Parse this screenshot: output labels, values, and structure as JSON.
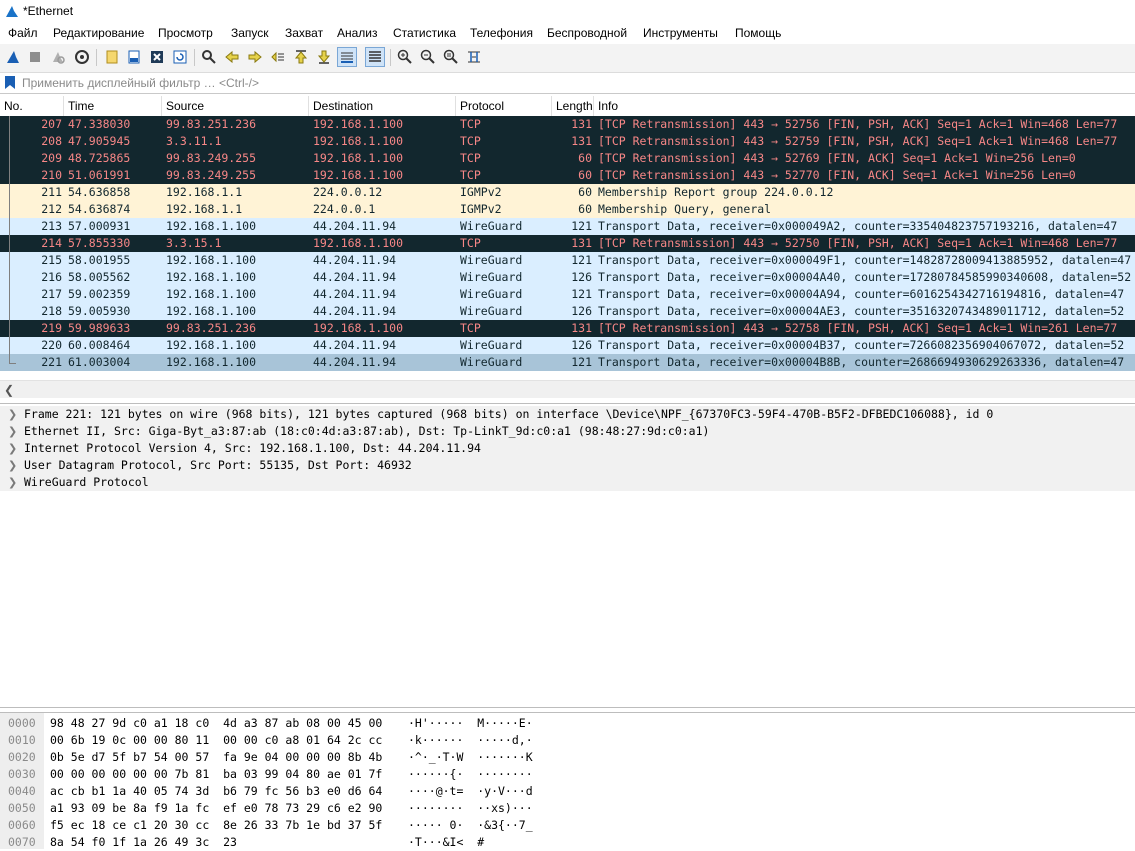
{
  "window": {
    "title": "*Ethernet"
  },
  "menu": [
    "Файл",
    "Редактирование",
    "Просмотр",
    "Запуск",
    "Захват",
    "Анализ",
    "Статистика",
    "Телефония",
    "Беспроводной",
    "Инструменты",
    "Помощь"
  ],
  "toolbar": {
    "buttons": [
      "shark-fin-start-icon",
      "stop-icon",
      "restart-icon",
      "capture-options-icon",
      "open-file-icon",
      "save-file-icon",
      "close-file-icon",
      "reload-icon",
      "find-packet-icon",
      "go-back-icon",
      "go-forward-icon",
      "go-to-packet-icon",
      "go-first-icon",
      "go-last-icon",
      "autoscroll-icon",
      "colorize-icon",
      "zoom-in-icon",
      "zoom-out-icon",
      "zoom-reset-icon",
      "resize-columns-icon"
    ]
  },
  "filter": {
    "placeholder": "Применить дисплейный фильтр … <Ctrl-/>",
    "value": ""
  },
  "packet_list": {
    "columns": [
      "No.",
      "Time",
      "Source",
      "Destination",
      "Protocol",
      "Length",
      "Info"
    ],
    "rows": [
      {
        "no": "207",
        "time": "47.338030",
        "src": "99.83.251.236",
        "dst": "192.168.1.100",
        "proto": "TCP",
        "len": "131",
        "info": "[TCP Retransmission] 443 → 52756 [FIN, PSH, ACK] Seq=1 Ack=1 Win=468 Len=77",
        "style": "tcp-bad"
      },
      {
        "no": "208",
        "time": "47.905945",
        "src": "3.3.11.1",
        "dst": "192.168.1.100",
        "proto": "TCP",
        "len": "131",
        "info": "[TCP Retransmission] 443 → 52759 [FIN, PSH, ACK] Seq=1 Ack=1 Win=468 Len=77",
        "style": "tcp-bad"
      },
      {
        "no": "209",
        "time": "48.725865",
        "src": "99.83.249.255",
        "dst": "192.168.1.100",
        "proto": "TCP",
        "len": "60",
        "info": "[TCP Retransmission] 443 → 52769 [FIN, ACK] Seq=1 Ack=1 Win=256 Len=0",
        "style": "tcp-bad"
      },
      {
        "no": "210",
        "time": "51.061991",
        "src": "99.83.249.255",
        "dst": "192.168.1.100",
        "proto": "TCP",
        "len": "60",
        "info": "[TCP Retransmission] 443 → 52770 [FIN, ACK] Seq=1 Ack=1 Win=256 Len=0",
        "style": "tcp-bad"
      },
      {
        "no": "211",
        "time": "54.636858",
        "src": "192.168.1.1",
        "dst": "224.0.0.12",
        "proto": "IGMPv2",
        "len": "60",
        "info": "Membership Report group 224.0.0.12",
        "style": "igmp"
      },
      {
        "no": "212",
        "time": "54.636874",
        "src": "192.168.1.1",
        "dst": "224.0.0.1",
        "proto": "IGMPv2",
        "len": "60",
        "info": "Membership Query, general",
        "style": "igmp"
      },
      {
        "no": "213",
        "time": "57.000931",
        "src": "192.168.1.100",
        "dst": "44.204.11.94",
        "proto": "WireGuard",
        "len": "121",
        "info": "Transport Data, receiver=0x000049A2, counter=335404823757193216, datalen=47",
        "style": "wg"
      },
      {
        "no": "214",
        "time": "57.855330",
        "src": "3.3.15.1",
        "dst": "192.168.1.100",
        "proto": "TCP",
        "len": "131",
        "info": "[TCP Retransmission] 443 → 52750 [FIN, PSH, ACK] Seq=1 Ack=1 Win=468 Len=77",
        "style": "tcp-bad"
      },
      {
        "no": "215",
        "time": "58.001955",
        "src": "192.168.1.100",
        "dst": "44.204.11.94",
        "proto": "WireGuard",
        "len": "121",
        "info": "Transport Data, receiver=0x000049F1, counter=14828728009413885952, datalen=47",
        "style": "wg"
      },
      {
        "no": "216",
        "time": "58.005562",
        "src": "192.168.1.100",
        "dst": "44.204.11.94",
        "proto": "WireGuard",
        "len": "126",
        "info": "Transport Data, receiver=0x00004A40, counter=17280784585990340608, datalen=52",
        "style": "wg"
      },
      {
        "no": "217",
        "time": "59.002359",
        "src": "192.168.1.100",
        "dst": "44.204.11.94",
        "proto": "WireGuard",
        "len": "121",
        "info": "Transport Data, receiver=0x00004A94, counter=6016254342716194816, datalen=47",
        "style": "wg"
      },
      {
        "no": "218",
        "time": "59.005930",
        "src": "192.168.1.100",
        "dst": "44.204.11.94",
        "proto": "WireGuard",
        "len": "126",
        "info": "Transport Data, receiver=0x00004AE3, counter=3516320743489011712, datalen=52",
        "style": "wg"
      },
      {
        "no": "219",
        "time": "59.989633",
        "src": "99.83.251.236",
        "dst": "192.168.1.100",
        "proto": "TCP",
        "len": "131",
        "info": "[TCP Retransmission] 443 → 52758 [FIN, PSH, ACK] Seq=1 Ack=1 Win=261 Len=77",
        "style": "tcp-bad"
      },
      {
        "no": "220",
        "time": "60.008464",
        "src": "192.168.1.100",
        "dst": "44.204.11.94",
        "proto": "WireGuard",
        "len": "126",
        "info": "Transport Data, receiver=0x00004B37, counter=7266082356904067072, datalen=52",
        "style": "wg"
      },
      {
        "no": "221",
        "time": "61.003004",
        "src": "192.168.1.100",
        "dst": "44.204.11.94",
        "proto": "WireGuard",
        "len": "121",
        "info": "Transport Data, receiver=0x00004B8B, counter=2686694930629263336, datalen=47",
        "style": "selected"
      }
    ]
  },
  "details": [
    "Frame 221: 121 bytes on wire (968 bits), 121 bytes captured (968 bits) on interface \\Device\\NPF_{67370FC3-59F4-470B-B5F2-DFBEDC106088}, id 0",
    "Ethernet II, Src: Giga-Byt_a3:87:ab (18:c0:4d:a3:87:ab), Dst: Tp-LinkT_9d:c0:a1 (98:48:27:9d:c0:a1)",
    "Internet Protocol Version 4, Src: 192.168.1.100, Dst: 44.204.11.94",
    "User Datagram Protocol, Src Port: 55135, Dst Port: 46932",
    "WireGuard Protocol"
  ],
  "bytes": [
    {
      "offset": "0000",
      "hex": "98 48 27 9d c0 a1 18 c0  4d a3 87 ab 08 00 45 00",
      "ascii": "·H'·····  M·····E·"
    },
    {
      "offset": "0010",
      "hex": "00 6b 19 0c 00 00 80 11  00 00 c0 a8 01 64 2c cc",
      "ascii": "·k······  ·····d,·"
    },
    {
      "offset": "0020",
      "hex": "0b 5e d7 5f b7 54 00 57  fa 9e 04 00 00 00 8b 4b",
      "ascii": "·^·_·T·W  ·······K"
    },
    {
      "offset": "0030",
      "hex": "00 00 00 00 00 00 7b 81  ba 03 99 04 80 ae 01 7f",
      "ascii": "······{·  ········"
    },
    {
      "offset": "0040",
      "hex": "ac cb b1 1a 40 05 74 3d  b6 79 fc 56 b3 e0 d6 64",
      "ascii": "····@·t=  ·y·V···d"
    },
    {
      "offset": "0050",
      "hex": "a1 93 09 be 8a f9 1a fc  ef e0 78 73 29 c6 e2 90",
      "ascii": "········  ··xs)···"
    },
    {
      "offset": "0060",
      "hex": "f5 ec 18 ce c1 20 30 cc  8e 26 33 7b 1e bd 37 5f",
      "ascii": "····· 0·  ·&3{··7_"
    },
    {
      "offset": "0070",
      "hex": "8a 54 f0 1f 1a 26 49 3c  23",
      "ascii": "·T···&I<  #"
    }
  ]
}
